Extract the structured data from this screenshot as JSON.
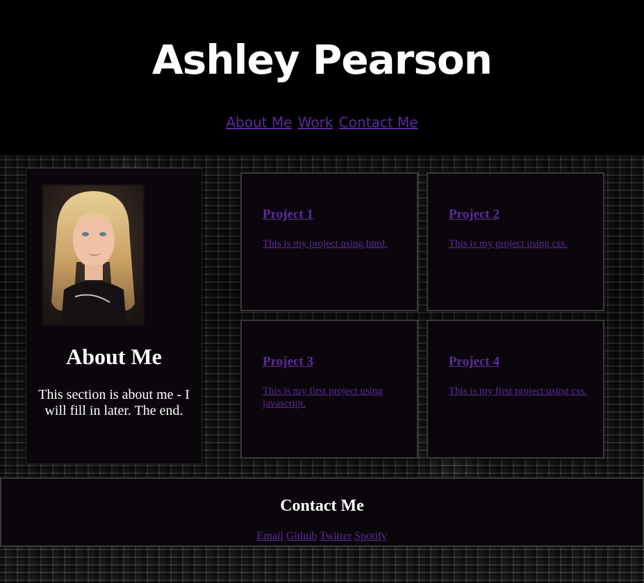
{
  "header": {
    "title": "Ashley Pearson",
    "nav": [
      "About Me",
      "Work",
      "Contact Me"
    ]
  },
  "about": {
    "heading": "About Me",
    "text": "This section is about me - I will fill in later. The end."
  },
  "projects": [
    {
      "title": "Project 1",
      "desc": "This is my project using html."
    },
    {
      "title": "Project 2",
      "desc": "This is my project using css."
    },
    {
      "title": "Project 3",
      "desc": "This is my first project using javascript."
    },
    {
      "title": "Project 4",
      "desc": "This is my first project using css."
    }
  ],
  "contact": {
    "heading": "Contact Me",
    "links": [
      "Email",
      "Github",
      "Twitter",
      "Spotify"
    ]
  },
  "colors": {
    "link": "#5b2b9e",
    "panel": "#0b060c",
    "header_bg": "#000000"
  },
  "icons": {
    "profile_photo": "portrait-photo"
  }
}
